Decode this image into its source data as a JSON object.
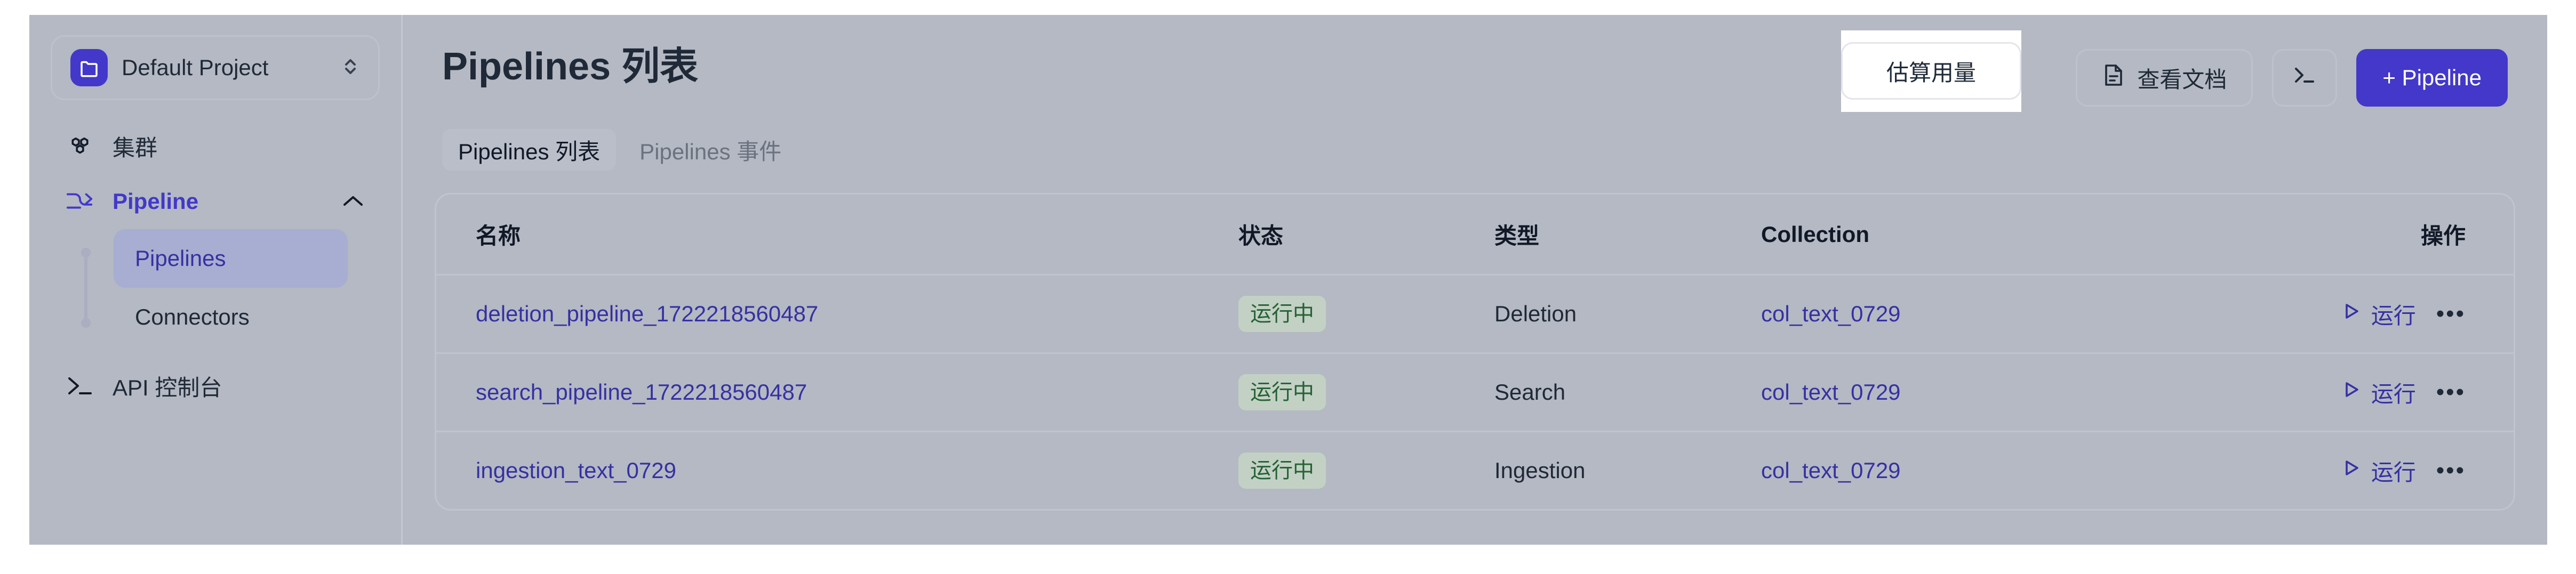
{
  "sidebar": {
    "project": {
      "name": "Default Project",
      "icon": "folder-icon",
      "selector_icon": "chevron-up-down-icon"
    },
    "items": [
      {
        "label": "集群",
        "icon": "cluster-icon",
        "active": false
      },
      {
        "label": "Pipeline",
        "icon": "pipeline-arrow-icon",
        "active": true,
        "expanded": true,
        "chevron": "chevron-up-icon"
      },
      {
        "label": "API 控制台",
        "icon": "terminal-icon",
        "active": false
      }
    ],
    "sub_items": [
      {
        "label": "Pipelines",
        "selected": true
      },
      {
        "label": "Connectors",
        "selected": false
      }
    ]
  },
  "header": {
    "title": "Pipelines 列表",
    "actions": {
      "estimate_usage": "估算用量",
      "view_docs": "查看文档",
      "docs_icon": "document-icon",
      "terminal_icon": "terminal-icon",
      "create_pipeline": "+ Pipeline"
    }
  },
  "tabs": [
    {
      "label": "Pipelines 列表",
      "active": true
    },
    {
      "label": "Pipelines 事件",
      "active": false
    }
  ],
  "table": {
    "columns": [
      "名称",
      "状态",
      "类型",
      "Collection",
      "操作"
    ],
    "rows": [
      {
        "name": "deletion_pipeline_1722218560487",
        "status": "运行中",
        "type": "Deletion",
        "collection": "col_text_0729",
        "run_label": "运行",
        "more_label": "•••"
      },
      {
        "name": "search_pipeline_1722218560487",
        "status": "运行中",
        "type": "Search",
        "collection": "col_text_0729",
        "run_label": "运行",
        "more_label": "•••"
      },
      {
        "name": "ingestion_text_0729",
        "status": "运行中",
        "type": "Ingestion",
        "collection": "col_text_0729",
        "run_label": "运行",
        "more_label": "•••"
      }
    ]
  },
  "colors": {
    "brand": "#4338ca",
    "link": "#3730a3",
    "status_bg": "#c3d1c5",
    "status_text": "#256235",
    "page_bg": "#b4b9c3"
  }
}
